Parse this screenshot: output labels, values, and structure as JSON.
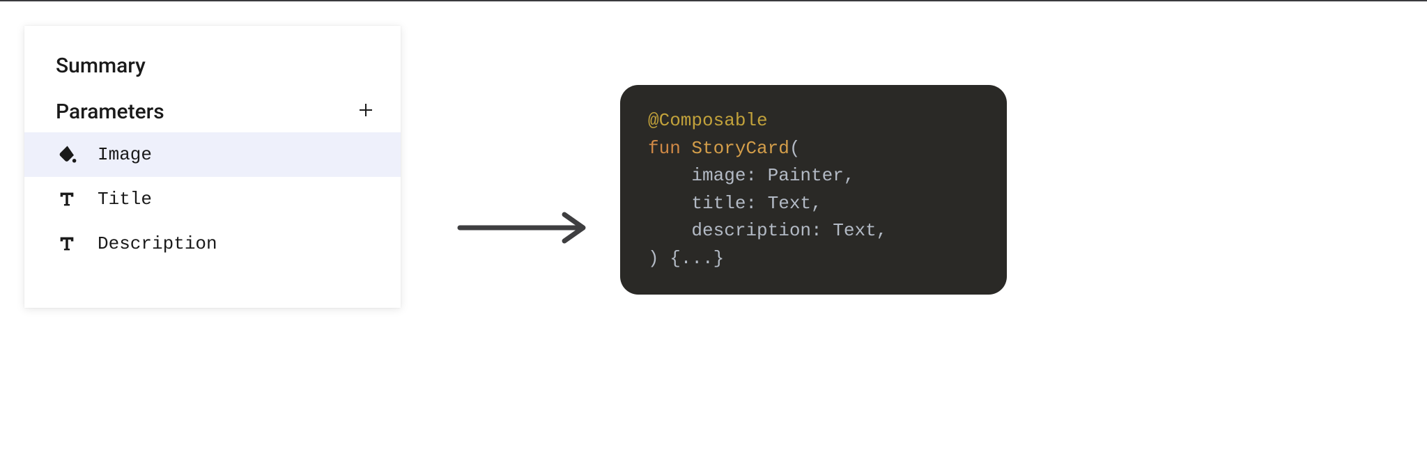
{
  "panel": {
    "summary_label": "Summary",
    "parameters_label": "Parameters",
    "rows": {
      "image": {
        "label": "Image",
        "type": "paint",
        "selected": true
      },
      "title": {
        "label": "Title",
        "type": "text",
        "selected": false
      },
      "description": {
        "label": "Description",
        "type": "text",
        "selected": false
      }
    }
  },
  "code": {
    "annotation": "@Composable",
    "keyword_fun": "fun",
    "func_name": "StoryCard",
    "open_paren": "(",
    "params": {
      "image": "    image: Painter,",
      "title": "    title: Text,",
      "description": "    description: Text,"
    },
    "close": ") {...}"
  }
}
